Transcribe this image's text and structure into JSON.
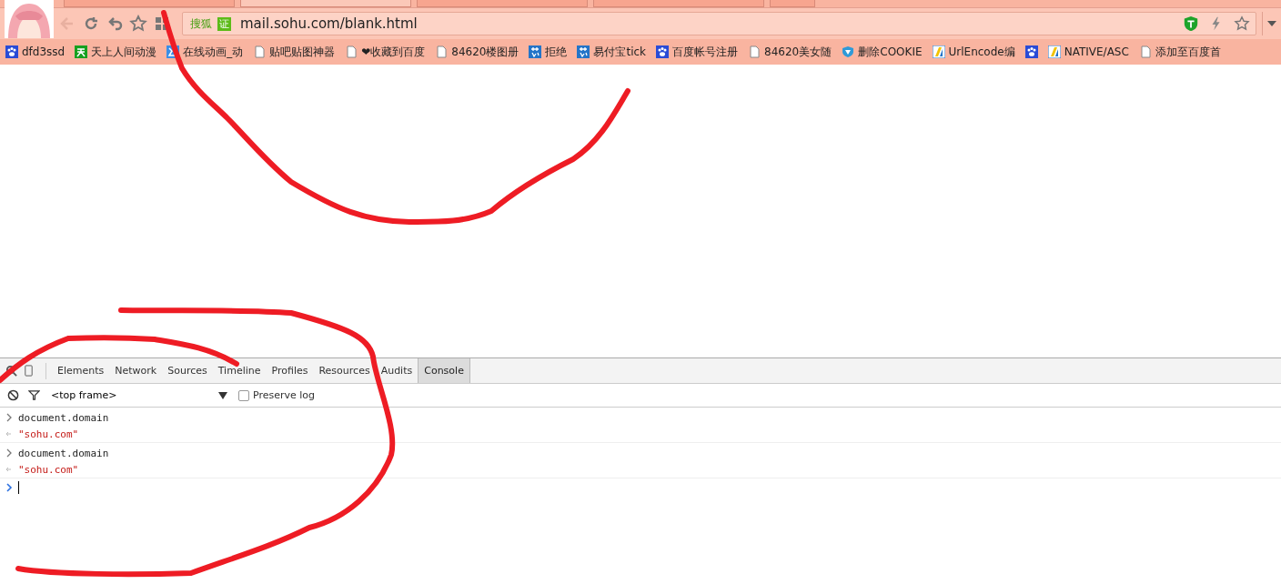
{
  "browser": {
    "tabs": [
      {
        "selected": false
      },
      {
        "selected": true
      },
      {
        "selected": false
      },
      {
        "selected": false
      }
    ],
    "address": {
      "site_badge": "搜狐",
      "cert_badge": "证",
      "url": "mail.sohu.com/blank.html"
    },
    "bookmarks": [
      {
        "kind": "paw",
        "label": "dfd3ssd"
      },
      {
        "kind": "tian",
        "label": "天上人间动漫"
      },
      {
        "kind": "blue",
        "label": "在线动画_动"
      },
      {
        "kind": "page",
        "label": "贴吧贴图神器"
      },
      {
        "kind": "page",
        "label": "❤收藏到百度"
      },
      {
        "kind": "page",
        "label": "84620楼图册"
      },
      {
        "kind": "su",
        "label": "拒绝"
      },
      {
        "kind": "su",
        "label": "易付宝tick"
      },
      {
        "kind": "paw",
        "label": "百度帐号注册"
      },
      {
        "kind": "page",
        "label": "84620美女随"
      },
      {
        "kind": "shield",
        "label": "删除COOKIE"
      },
      {
        "kind": "flag",
        "label": "UrlEncode编"
      },
      {
        "kind": "paw"
      },
      {
        "kind": "flag",
        "label": "NATIVE/ASC"
      },
      {
        "kind": "page",
        "label": "添加至百度首"
      }
    ]
  },
  "devtools": {
    "tabs": [
      {
        "label": "Elements",
        "selected": false
      },
      {
        "label": "Network",
        "selected": false
      },
      {
        "label": "Sources",
        "selected": false
      },
      {
        "label": "Timeline",
        "selected": false
      },
      {
        "label": "Profiles",
        "selected": false
      },
      {
        "label": "Resources",
        "selected": false
      },
      {
        "label": "Audits",
        "selected": false
      },
      {
        "label": "Console",
        "selected": true
      }
    ],
    "frame_selector": "<top frame>",
    "preserve_log": {
      "label": "Preserve log",
      "checked": false
    },
    "console": [
      {
        "kind": "input",
        "text": "document.domain"
      },
      {
        "kind": "output",
        "text": "\"sohu.com\""
      },
      {
        "kind": "input",
        "text": "document.domain"
      },
      {
        "kind": "output",
        "text": "\"sohu.com\""
      }
    ]
  }
}
